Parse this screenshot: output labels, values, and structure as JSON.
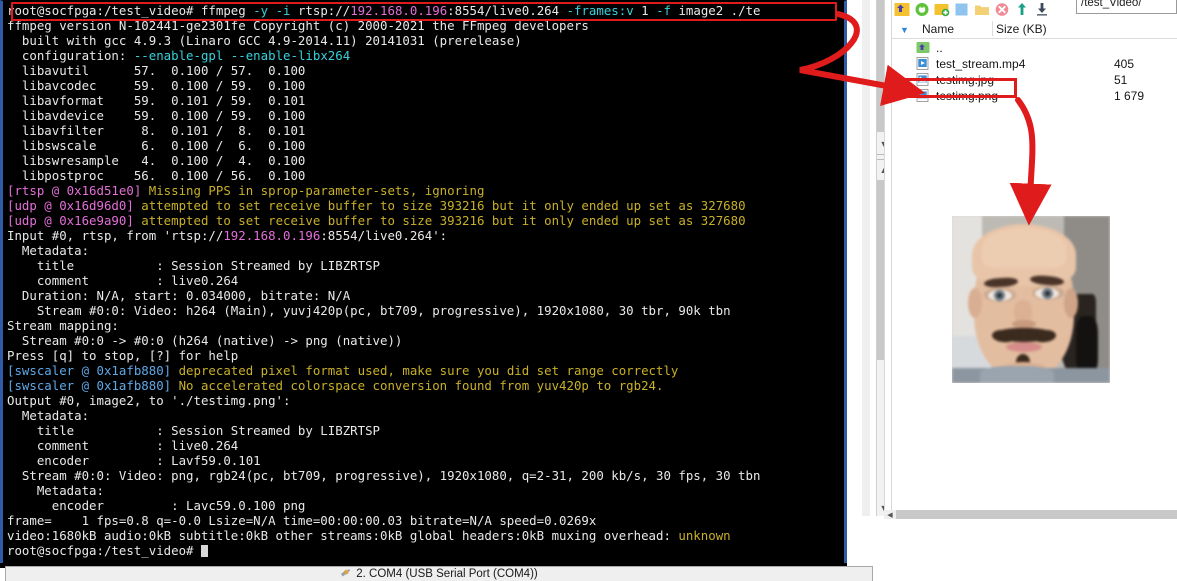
{
  "terminal": {
    "prompt_line": "root@socfpga:/test_video# ffmpeg -y -i rtsp://192.168.0.196:8554/live0.264 -frames:v 1 -f image2 ./te",
    "command_parts": {
      "prompt": "root@socfpga:/test_video# ",
      "cmd": "ffmpeg ",
      "flag_y": "-y",
      "flag_i": "-i",
      "url_scheme": "rtsp://",
      "url_ip": "192.168.0.196",
      "url_rest": ":8554/live0.264 ",
      "flag_frames": "-frames:v",
      "frames_val": " 1 ",
      "flag_f": "-f",
      "f_val": " image2 ./te"
    },
    "lines": [
      "ffmpeg version N-102441-ge2301fe Copyright (c) 2000-2021 the FFmpeg developers",
      "  built with gcc 4.9.3 (Linaro GCC 4.9-2014.11) 20141031 (prerelease)",
      "  configuration: --enable-gpl --enable-libx264",
      "  libavutil      57.  0.100 / 57.  0.100",
      "  libavcodec     59.  0.100 / 59.  0.100",
      "  libavformat    59.  0.101 / 59.  0.101",
      "  libavdevice    59.  0.100 / 59.  0.100",
      "  libavfilter     8.  0.101 /  8.  0.101",
      "  libswscale      6.  0.100 /  6.  0.100",
      "  libswresample   4.  0.100 /  4.  0.100",
      "  libpostproc    56.  0.100 / 56.  0.100",
      "[rtsp @ 0x16d51e0] Missing PPS in sprop-parameter-sets, ignoring",
      "[udp @ 0x16d96d0] attempted to set receive buffer to size 393216 but it only ended up set as 327680",
      "[udp @ 0x16e9a90] attempted to set receive buffer to size 393216 but it only ended up set as 327680",
      "Input #0, rtsp, from 'rtsp://192.168.0.196:8554/live0.264':",
      "  Metadata:",
      "    title           : Session Streamed by LIBZRTSP",
      "    comment         : live0.264",
      "  Duration: N/A, start: 0.034000, bitrate: N/A",
      "    Stream #0:0: Video: h264 (Main), yuvj420p(pc, bt709, progressive), 1920x1080, 30 tbr, 90k tbn",
      "Stream mapping:",
      "  Stream #0:0 -> #0:0 (h264 (native) -> png (native))",
      "Press [q] to stop, [?] for help",
      "[swscaler @ 0x1afb880] deprecated pixel format used, make sure you did set range correctly",
      "[swscaler @ 0x1afb880] No accelerated colorspace conversion found from yuv420p to rgb24.",
      "Output #0, image2, to './testimg.png':",
      "  Metadata:",
      "    title           : Session Streamed by LIBZRTSP",
      "    comment         : live0.264",
      "    encoder         : Lavf59.0.101",
      "  Stream #0:0: Video: png, rgb24(pc, bt709, progressive), 1920x1080, q=2-31, 200 kb/s, 30 fps, 30 tbn",
      "    Metadata:",
      "      encoder         : Lavc59.0.100 png",
      "frame=    1 fps=0.8 q=-0.0 Lsize=N/A time=00:00:00.03 bitrate=N/A speed=0.0269x",
      "video:1680kB audio:0kB subtitle:0kB other streams:0kB global headers:0kB muxing overhead: unknown",
      "root@socfpga:/test_video# "
    ],
    "final_prompt": "root@socfpga:/test_video# ",
    "colors": {
      "background": "#000000",
      "foreground": "#e6e6e6",
      "cyan": "#36d1dc",
      "yellow": "#c8b028",
      "magenta": "#e36fd8",
      "blue": "#5fa8e8",
      "highlight_box": "#e01b1b",
      "window_border": "#2f5ba7"
    }
  },
  "statusbar": {
    "text": "2. COM4  (USB Serial Port (COM4))",
    "icon": "serial-plug-icon"
  },
  "file_explorer": {
    "toolbar": {
      "icons": [
        "parent-directory-icon",
        "refresh-icon",
        "new-folder-icon",
        "new-file-icon",
        "folder-icon",
        "delete-icon",
        "upload-icon",
        "download-icon"
      ]
    },
    "path": {
      "value": "/test_Video/",
      "placeholder": "/"
    },
    "columns": {
      "name": "Name",
      "size": "Size (KB)",
      "sort_indicator": "descending"
    },
    "rows": [
      {
        "icon": "parent-folder-icon",
        "name": "..",
        "size": ""
      },
      {
        "icon": "video-file-icon",
        "name": "test_stream.mp4",
        "size": "405"
      },
      {
        "icon": "image-file-icon",
        "name": "testimg.jpg",
        "size": "51"
      },
      {
        "icon": "image-file-icon",
        "name": "testimg.png",
        "size": "1 679"
      }
    ],
    "highlighted_row": "testimg.jpg"
  },
  "preview": {
    "name": "image-preview",
    "description": "photo of a person's face"
  },
  "annotations": {
    "color": "#e01b1b",
    "arrow_command_to_file": "arrow-command-to-testimg-jpg",
    "arrow_file_to_preview": "arrow-testimg-jpg-to-preview"
  }
}
